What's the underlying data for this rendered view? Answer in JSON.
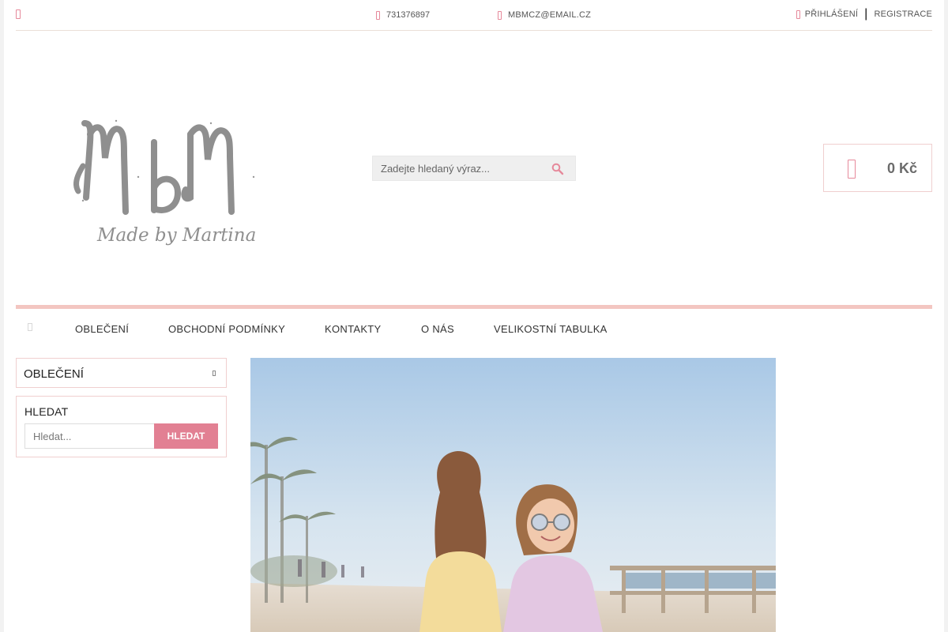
{
  "topbar": {
    "menu_icon": "menu-icon",
    "phone": "731376897",
    "email": "MBMCZ@EMAIL.CZ",
    "login": "PŘIHLÁŠENÍ",
    "separator": "|",
    "register": "REGISTRACE"
  },
  "header": {
    "logo_text": "MbM",
    "logo_subtitle": "Made by Martina",
    "search_placeholder": "Zadejte hledaný výraz...",
    "cart_total": "0 Kč"
  },
  "nav": {
    "home_icon": "home-icon",
    "items": [
      {
        "label": "OBLEČENÍ"
      },
      {
        "label": "OBCHODNÍ PODMÍNKY"
      },
      {
        "label": "KONTAKTY"
      },
      {
        "label": "O NÁS"
      },
      {
        "label": "VELIKOSTNÍ TABULKA"
      }
    ]
  },
  "sidebar": {
    "category_label": "OBLEČENÍ",
    "search_title": "HLEDAT",
    "search_placeholder": "Hledat...",
    "search_button": "HLEDAT"
  },
  "colors": {
    "accent": "#e28093",
    "border_pink": "#f0cfcf",
    "nav_rule": "#f3c6c1"
  }
}
